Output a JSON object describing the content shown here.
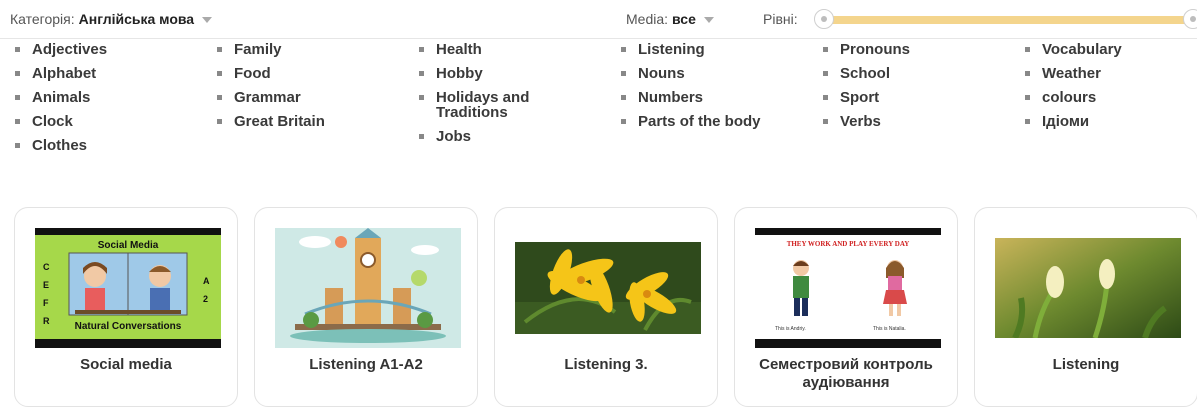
{
  "filters": {
    "category_label": "Категорія:",
    "category_value": "Англійська мова",
    "media_label": "Media:",
    "media_value": "все",
    "levels_label": "Рівні:"
  },
  "categories": [
    [
      "Adjectives",
      "Alphabet",
      "Animals",
      "Clock",
      "Clothes"
    ],
    [
      "Family",
      "Food",
      "Grammar",
      "Great Britain"
    ],
    [
      "Health",
      "Hobby",
      "Holidays and Traditions",
      "Jobs"
    ],
    [
      "Listening",
      "Nouns",
      "Numbers",
      "Parts of the body"
    ],
    [
      "Pronouns",
      "School",
      "Sport",
      "Verbs"
    ],
    [
      "Vocabulary",
      "Weather",
      "colours",
      "Ідіоми"
    ]
  ],
  "cards": [
    {
      "title": "Social media",
      "thumb_texts": {
        "top": "Social Media",
        "left": "C E F R",
        "right": "A 2",
        "bottom": "Natural Conversations"
      }
    },
    {
      "title": "Listening A1-A2"
    },
    {
      "title": "Listening 3."
    },
    {
      "title": "Семестровий контроль аудіювання",
      "thumb_texts": {
        "top": "THEY WORK AND PLAY EVERY DAY",
        "left": "This is Andriy.",
        "right": "This is Natalia."
      }
    },
    {
      "title": "Listening"
    }
  ],
  "colors": {
    "slider_track": "#f4d58d",
    "lime": "#a6d84a"
  }
}
